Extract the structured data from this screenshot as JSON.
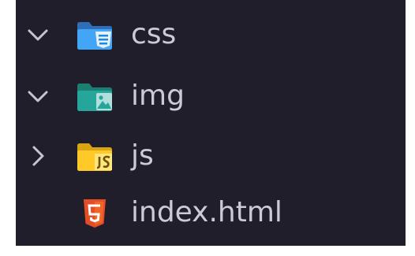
{
  "explorer": {
    "items": [
      {
        "label": "css",
        "type": "folder",
        "state": "expanded",
        "icon": "css-folder-icon",
        "color": "#42a5f5"
      },
      {
        "label": "img",
        "type": "folder",
        "state": "expanded",
        "icon": "image-folder-icon",
        "color": "#26a69a"
      },
      {
        "label": "js",
        "type": "folder",
        "state": "collapsed",
        "icon": "js-folder-icon",
        "color": "#ffca28"
      },
      {
        "label": "index.html",
        "type": "file",
        "icon": "html5-icon",
        "color": "#e44d26"
      }
    ]
  },
  "colors": {
    "background": "#211e2b",
    "text": "#cbcbd4",
    "chevron": "#c5c5cf"
  }
}
